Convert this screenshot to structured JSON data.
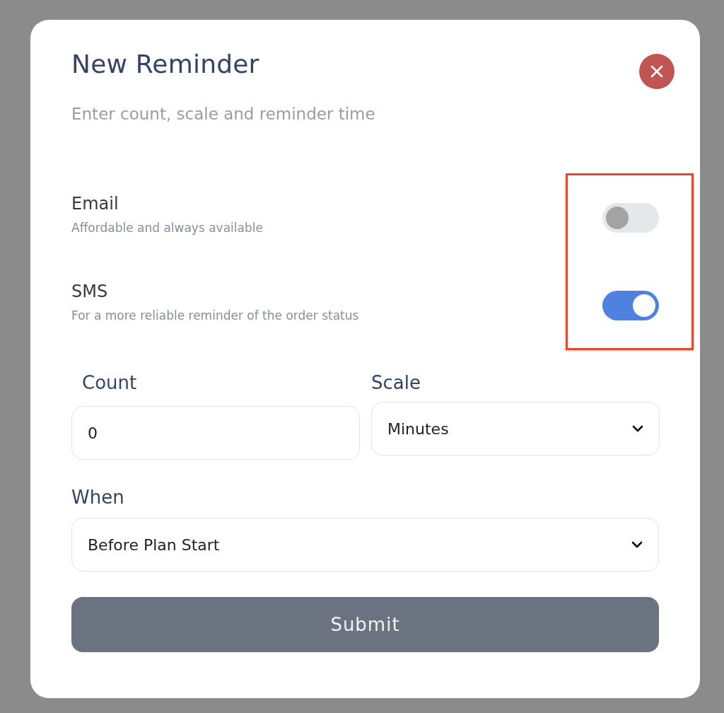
{
  "dialog": {
    "title": "New Reminder",
    "subtitle": "Enter count, scale and reminder time"
  },
  "channels": [
    {
      "label": "Email",
      "description": "Affordable and always available",
      "on": false
    },
    {
      "label": "SMS",
      "description": "For a more reliable reminder of the order status",
      "on": true
    }
  ],
  "count": {
    "label": "Count",
    "value": "0"
  },
  "scale": {
    "label": "Scale",
    "value": "Minutes"
  },
  "when": {
    "label": "When",
    "value": "Before Plan Start"
  },
  "submit": {
    "label": "Submit"
  }
}
